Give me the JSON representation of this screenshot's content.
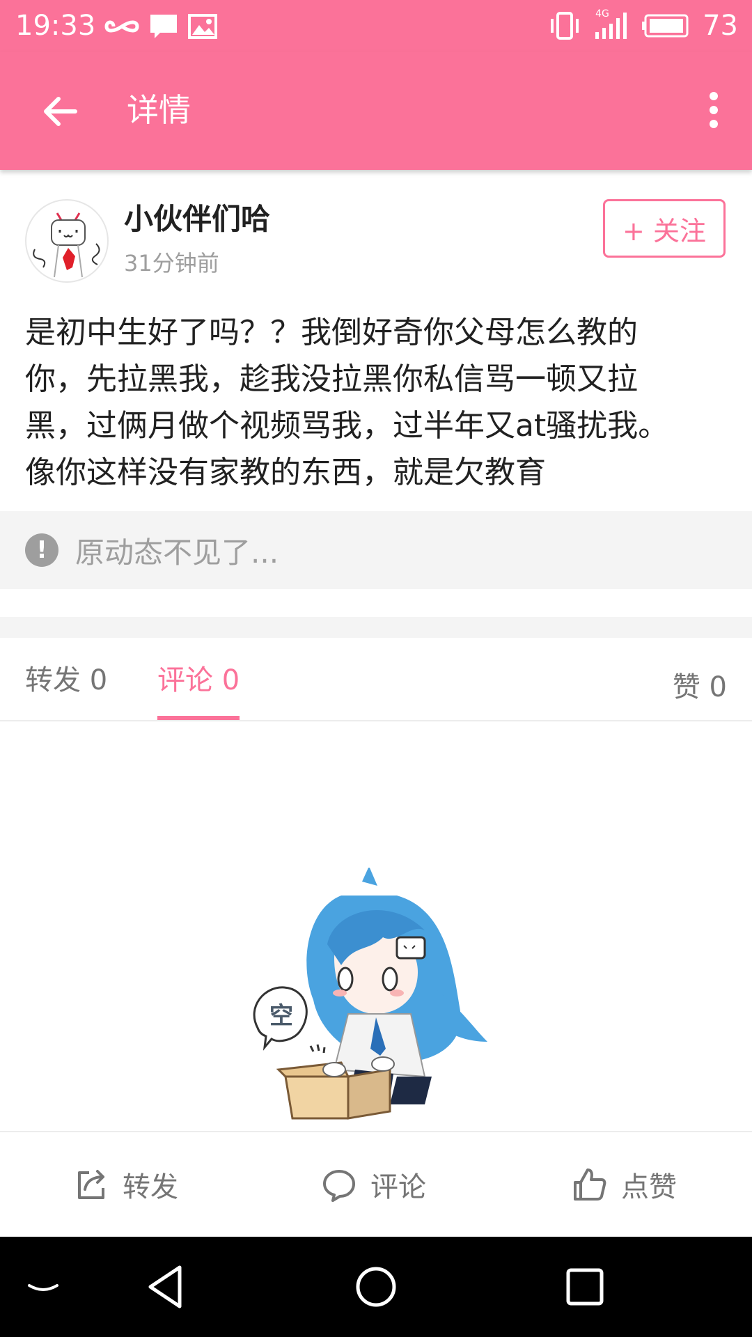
{
  "status_bar": {
    "time": "19:33",
    "battery_percent": "73",
    "network_label": "4G",
    "icons": [
      "infinity-icon",
      "message-icon",
      "image-icon",
      "vibrate-icon",
      "signal-4g-icon",
      "battery-icon"
    ]
  },
  "app_bar": {
    "title": "详情",
    "back_icon": "arrow-left-icon",
    "more_icon": "more-vertical-icon"
  },
  "post": {
    "author": "小伙伴们哈",
    "time_ago": "31分钟前",
    "follow_label": "+ 关注",
    "content_lines": [
      "是初中生好了吗？？我倒好奇你父母怎么教的",
      "你，先拉黑我，趁我没拉黑你私信骂一顿又拉",
      "黑，过俩月做个视频骂我，过半年又at骚扰我。",
      "像你这样没有家教的东西，就是欠教育"
    ],
    "original_missing": "原动态不见了..."
  },
  "tabs": {
    "repost": "转发 0",
    "comment": "评论 0",
    "like": "赞 0",
    "active": "comment"
  },
  "empty_state": {
    "bubble_text": "空"
  },
  "actions": {
    "repost": "转发",
    "comment": "评论",
    "like": "点赞"
  },
  "colors": {
    "brand_pink": "#fb7299",
    "text_primary": "#212121",
    "text_secondary": "#9e9e9e",
    "background_grey": "#f4f4f4"
  }
}
